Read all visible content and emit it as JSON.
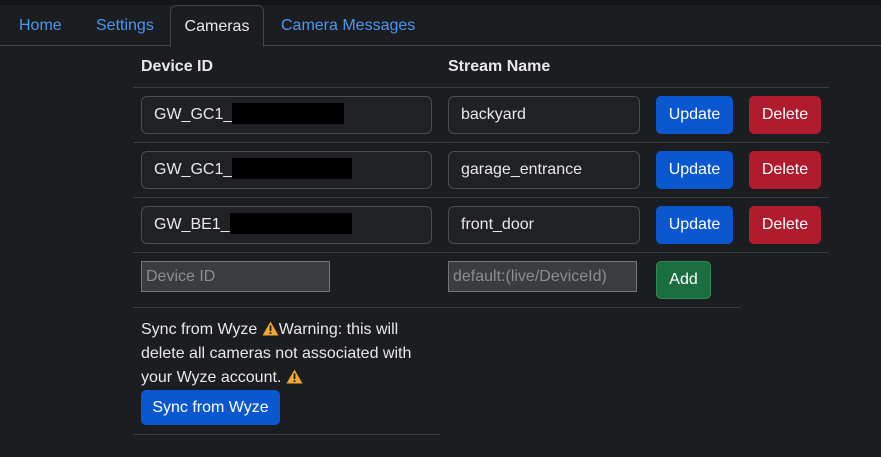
{
  "tabs": [
    {
      "label": "Home"
    },
    {
      "label": "Settings"
    },
    {
      "label": "Cameras"
    },
    {
      "label": "Camera Messages"
    }
  ],
  "table": {
    "headers": {
      "device_id": "Device ID",
      "stream_name": "Stream Name"
    },
    "rows": [
      {
        "device_id": "GW_GC1_",
        "stream_name": "backyard",
        "update_label": "Update",
        "delete_label": "Delete"
      },
      {
        "device_id": "GW_GC1_",
        "stream_name": "garage_entrance",
        "update_label": "Update",
        "delete_label": "Delete"
      },
      {
        "device_id": "GW_BE1_",
        "stream_name": "front_door",
        "update_label": "Update",
        "delete_label": "Delete"
      }
    ],
    "new_row": {
      "device_id_placeholder": "Device ID",
      "stream_name_placeholder": "default:(live/DeviceId)",
      "add_label": "Add"
    }
  },
  "sync": {
    "text_before": "Sync from Wyze",
    "warning_text": "Warning: this will delete all cameras not associated with your Wyze account.",
    "button_label": "Sync from Wyze"
  },
  "colors": {
    "background": "#1c1d20",
    "link": "#4b96f0",
    "primary": "#0b57d0",
    "danger": "#b01c2e",
    "success": "#1a6e3f",
    "warning": "#f0a830"
  }
}
